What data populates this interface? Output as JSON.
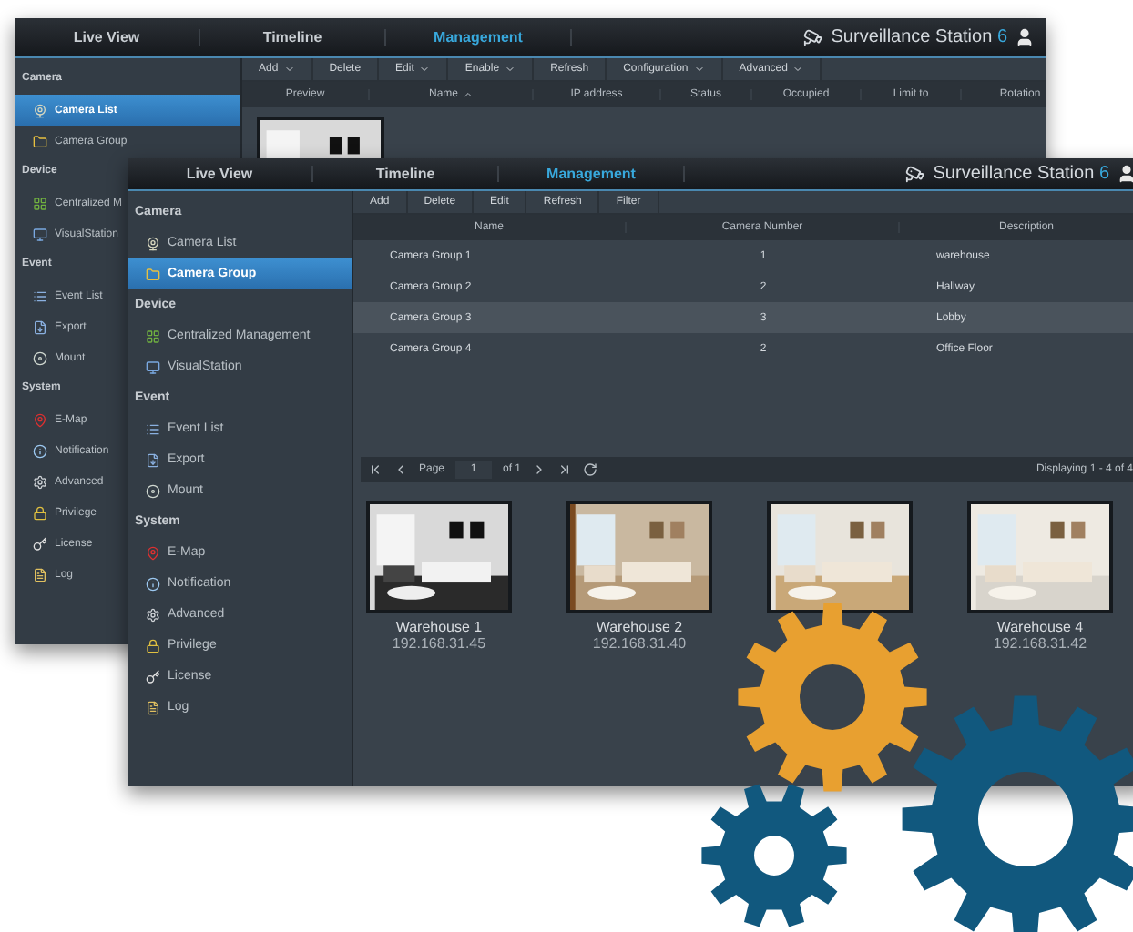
{
  "back_window": {
    "nav": {
      "tabs": [
        {
          "label": "Live View",
          "selected": false
        },
        {
          "label": "Timeline",
          "selected": false
        },
        {
          "label": "Management",
          "selected": true
        }
      ],
      "brand": {
        "name": "Surveillance Station",
        "version": "6"
      }
    },
    "toolbar": [
      {
        "label": "Add",
        "dropdown": true
      },
      {
        "label": "Delete",
        "dropdown": false
      },
      {
        "label": "Edit",
        "dropdown": true
      },
      {
        "label": "Enable",
        "dropdown": true
      },
      {
        "label": "Refresh",
        "dropdown": false
      },
      {
        "label": "Configuration",
        "dropdown": true
      },
      {
        "label": "Advanced",
        "dropdown": true
      }
    ],
    "columns": [
      {
        "label": "Preview",
        "sorted": false
      },
      {
        "label": "Name",
        "sorted": true
      },
      {
        "label": "IP address",
        "sorted": false
      },
      {
        "label": "Status",
        "sorted": false
      },
      {
        "label": "Occupied",
        "sorted": false
      },
      {
        "label": "Limit to",
        "sorted": false
      },
      {
        "label": "Rotation",
        "sorted": false
      }
    ],
    "sidebar": [
      {
        "title": "Camera",
        "items": [
          {
            "label": "Camera List",
            "selected": true
          },
          {
            "label": "Camera Group",
            "selected": false
          }
        ]
      },
      {
        "title": "Device",
        "items": [
          {
            "label": "Centralized M",
            "selected": false
          },
          {
            "label": "VisualStation",
            "selected": false
          }
        ]
      },
      {
        "title": "Event",
        "items": [
          {
            "label": "Event List",
            "selected": false
          },
          {
            "label": "Export",
            "selected": false
          },
          {
            "label": "Mount",
            "selected": false
          }
        ]
      },
      {
        "title": "System",
        "items": [
          {
            "label": "E-Map",
            "selected": false
          },
          {
            "label": "Notification",
            "selected": false
          },
          {
            "label": "Advanced",
            "selected": false
          },
          {
            "label": "Privilege",
            "selected": false
          },
          {
            "label": "License",
            "selected": false
          },
          {
            "label": "Log",
            "selected": false
          }
        ]
      }
    ]
  },
  "front_window": {
    "nav": {
      "tabs": [
        {
          "label": "Live View",
          "selected": false
        },
        {
          "label": "Timeline",
          "selected": false
        },
        {
          "label": "Management",
          "selected": true
        }
      ],
      "brand": {
        "name": "Surveillance Station",
        "version": "6"
      }
    },
    "sidebar": [
      {
        "title": "Camera",
        "items": [
          {
            "label": "Camera List",
            "selected": false
          },
          {
            "label": "Camera Group",
            "selected": true
          }
        ]
      },
      {
        "title": "Device",
        "items": [
          {
            "label": "Centralized Management",
            "selected": false
          },
          {
            "label": "VisualStation",
            "selected": false
          }
        ]
      },
      {
        "title": "Event",
        "items": [
          {
            "label": "Event List",
            "selected": false
          },
          {
            "label": "Export",
            "selected": false
          },
          {
            "label": "Mount",
            "selected": false
          }
        ]
      },
      {
        "title": "System",
        "items": [
          {
            "label": "E-Map",
            "selected": false
          },
          {
            "label": "Notification",
            "selected": false
          },
          {
            "label": "Advanced",
            "selected": false
          },
          {
            "label": "Privilege",
            "selected": false
          },
          {
            "label": "License",
            "selected": false
          },
          {
            "label": "Log",
            "selected": false
          }
        ]
      }
    ],
    "toolbar": [
      {
        "label": "Add"
      },
      {
        "label": "Delete"
      },
      {
        "label": "Edit"
      },
      {
        "label": "Refresh"
      },
      {
        "label": "Filter"
      }
    ],
    "table": {
      "columns": [
        "Name",
        "Camera Number",
        "Description"
      ],
      "rows": [
        {
          "name": "Camera Group 1",
          "number": "1",
          "description": "warehouse",
          "selected": false
        },
        {
          "name": "Camera Group 2",
          "number": "2",
          "description": "Hallway",
          "selected": false
        },
        {
          "name": "Camera Group 3",
          "number": "3",
          "description": "Lobby",
          "selected": true
        },
        {
          "name": "Camera Group 4",
          "number": "2",
          "description": "Office Floor",
          "selected": false
        }
      ]
    },
    "pager": {
      "page_label": "Page",
      "page": "1",
      "of": "of 1",
      "status": "Displaying 1 - 4 of 4"
    },
    "cameras": [
      {
        "name": "Warehouse 1",
        "ip": "192.168.31.45"
      },
      {
        "name": "Warehouse 2",
        "ip": "192.168.31.40"
      },
      {
        "kind": "picture"
      },
      {
        "name": "Warehouse 4",
        "ip": "192.168.31.42"
      }
    ]
  }
}
